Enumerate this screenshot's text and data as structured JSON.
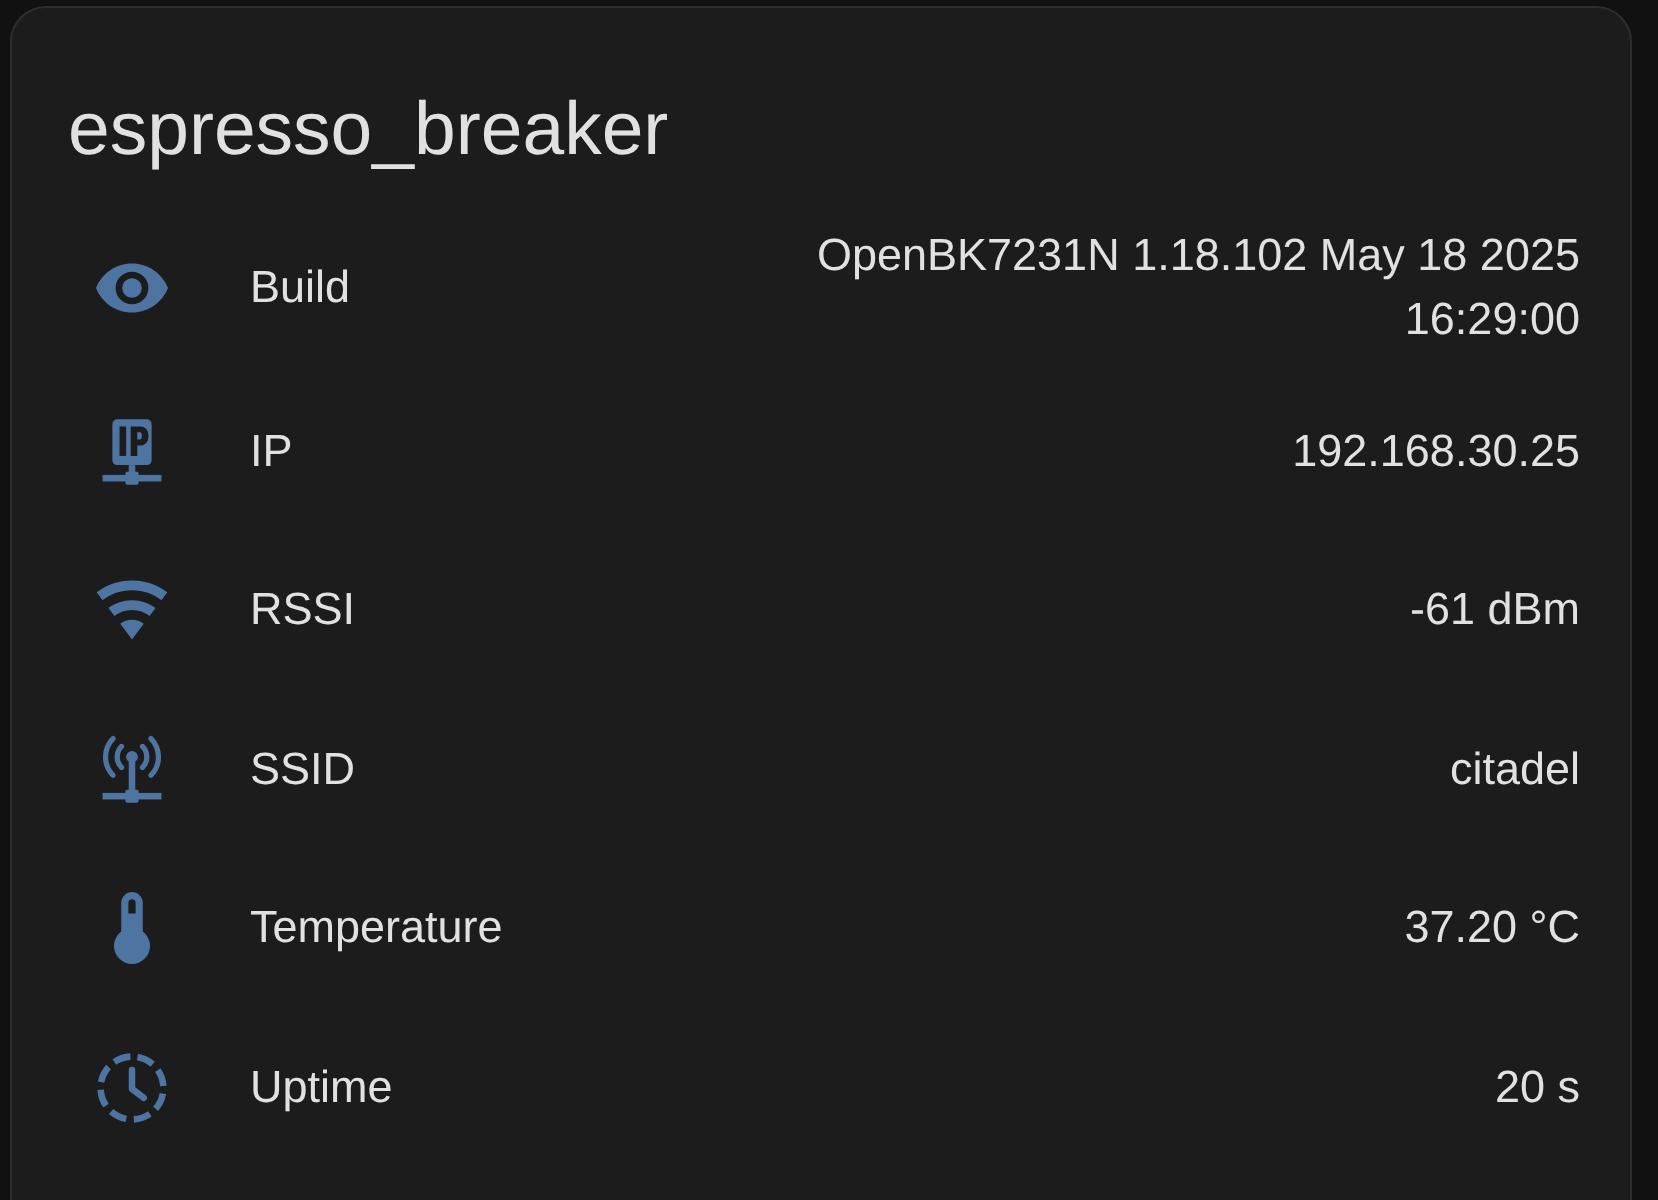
{
  "card": {
    "title": "espresso_breaker",
    "rows": [
      {
        "label": "Build",
        "value": "OpenBK7231N 1.18.102 May 18 2025 16:29:00"
      },
      {
        "label": "IP",
        "value": "192.168.30.25"
      },
      {
        "label": "RSSI",
        "value": "-61 dBm"
      },
      {
        "label": "SSID",
        "value": "citadel"
      },
      {
        "label": "Temperature",
        "value": "37.20 °C"
      },
      {
        "label": "Uptime",
        "value": "20 s"
      }
    ]
  }
}
